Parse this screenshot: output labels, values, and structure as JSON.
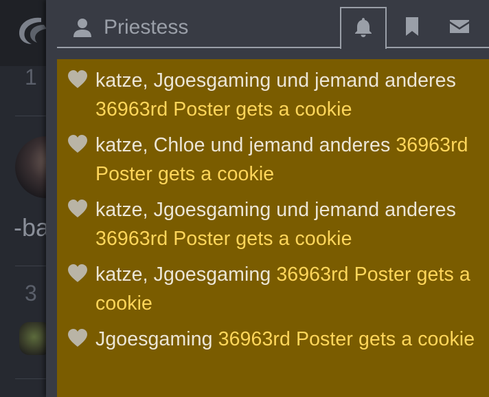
{
  "background": {
    "post_numbers": [
      "1",
      "3"
    ],
    "partial_text": "-ba"
  },
  "panel": {
    "user_tab": {
      "label": "Priestess",
      "icon": "user-icon"
    },
    "tabs": [
      {
        "icon": "bell-icon",
        "active": true
      },
      {
        "icon": "bookmark-icon",
        "active": false
      },
      {
        "icon": "envelope-icon",
        "active": false
      }
    ]
  },
  "notifications": [
    {
      "users": "katze, Jgoesgaming und jemand anderes",
      "title": "36963rd Poster gets a cookie",
      "icon": "heart-icon"
    },
    {
      "users": "katze, Chloe und jemand anderes",
      "title": "36963rd Poster gets a cookie",
      "icon": "heart-icon"
    },
    {
      "users": "katze, Jgoesgaming und jemand anderes",
      "title": "36963rd Poster gets a cookie",
      "icon": "heart-icon"
    },
    {
      "users": "katze, Jgoesgaming",
      "title": "36963rd Poster gets a cookie",
      "icon": "heart-icon"
    },
    {
      "users": "Jgoesgaming",
      "title": "36963rd Poster gets a cookie",
      "icon": "heart-icon"
    }
  ],
  "colors": {
    "panel_bg": "#383b44",
    "notification_bg": "#7a5c00",
    "title_text": "#ffd65a",
    "user_text": "#ece6d6",
    "icon_gray": "#9a9fa8"
  }
}
